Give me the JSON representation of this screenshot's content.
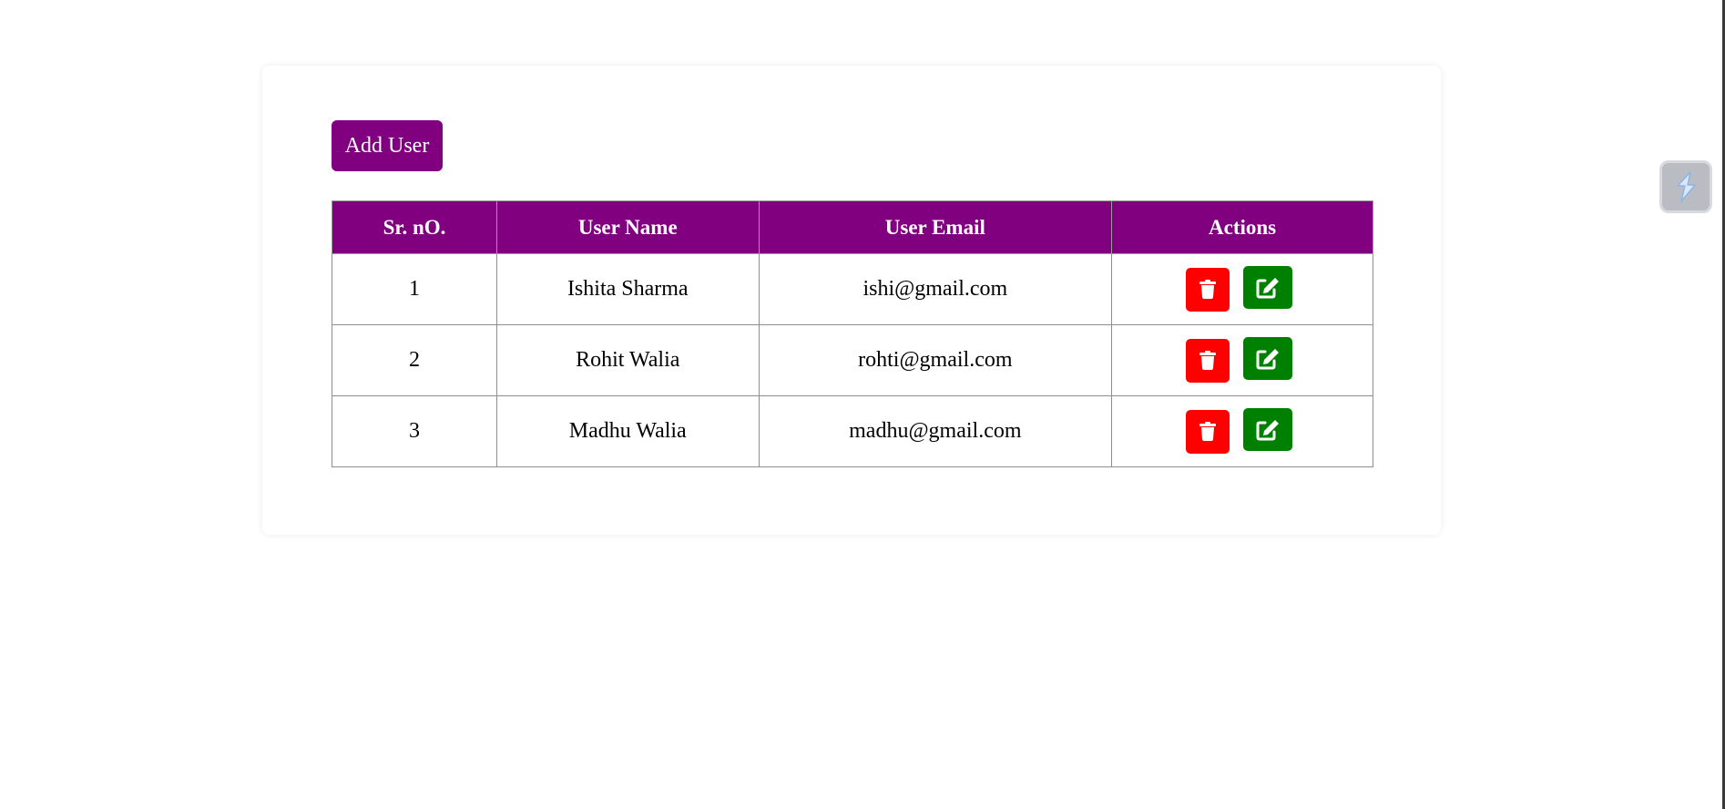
{
  "toolbar": {
    "add_user_label": "Add User"
  },
  "table": {
    "headers": {
      "sr": "Sr. nO.",
      "name": "User Name",
      "email": "User Email",
      "actions": "Actions"
    },
    "rows": [
      {
        "sr": "1",
        "name": "Ishita Sharma",
        "email": "ishi@gmail.com"
      },
      {
        "sr": "2",
        "name": "Rohit Walia",
        "email": "rohti@gmail.com"
      },
      {
        "sr": "3",
        "name": "Madhu Walia",
        "email": "madhu@gmail.com"
      }
    ]
  },
  "icons": {
    "delete": "trash-icon",
    "edit": "edit-icon",
    "widget": "lightning-icon"
  },
  "colors": {
    "accent": "#800080",
    "delete": "#ff0000",
    "edit": "#008000"
  }
}
